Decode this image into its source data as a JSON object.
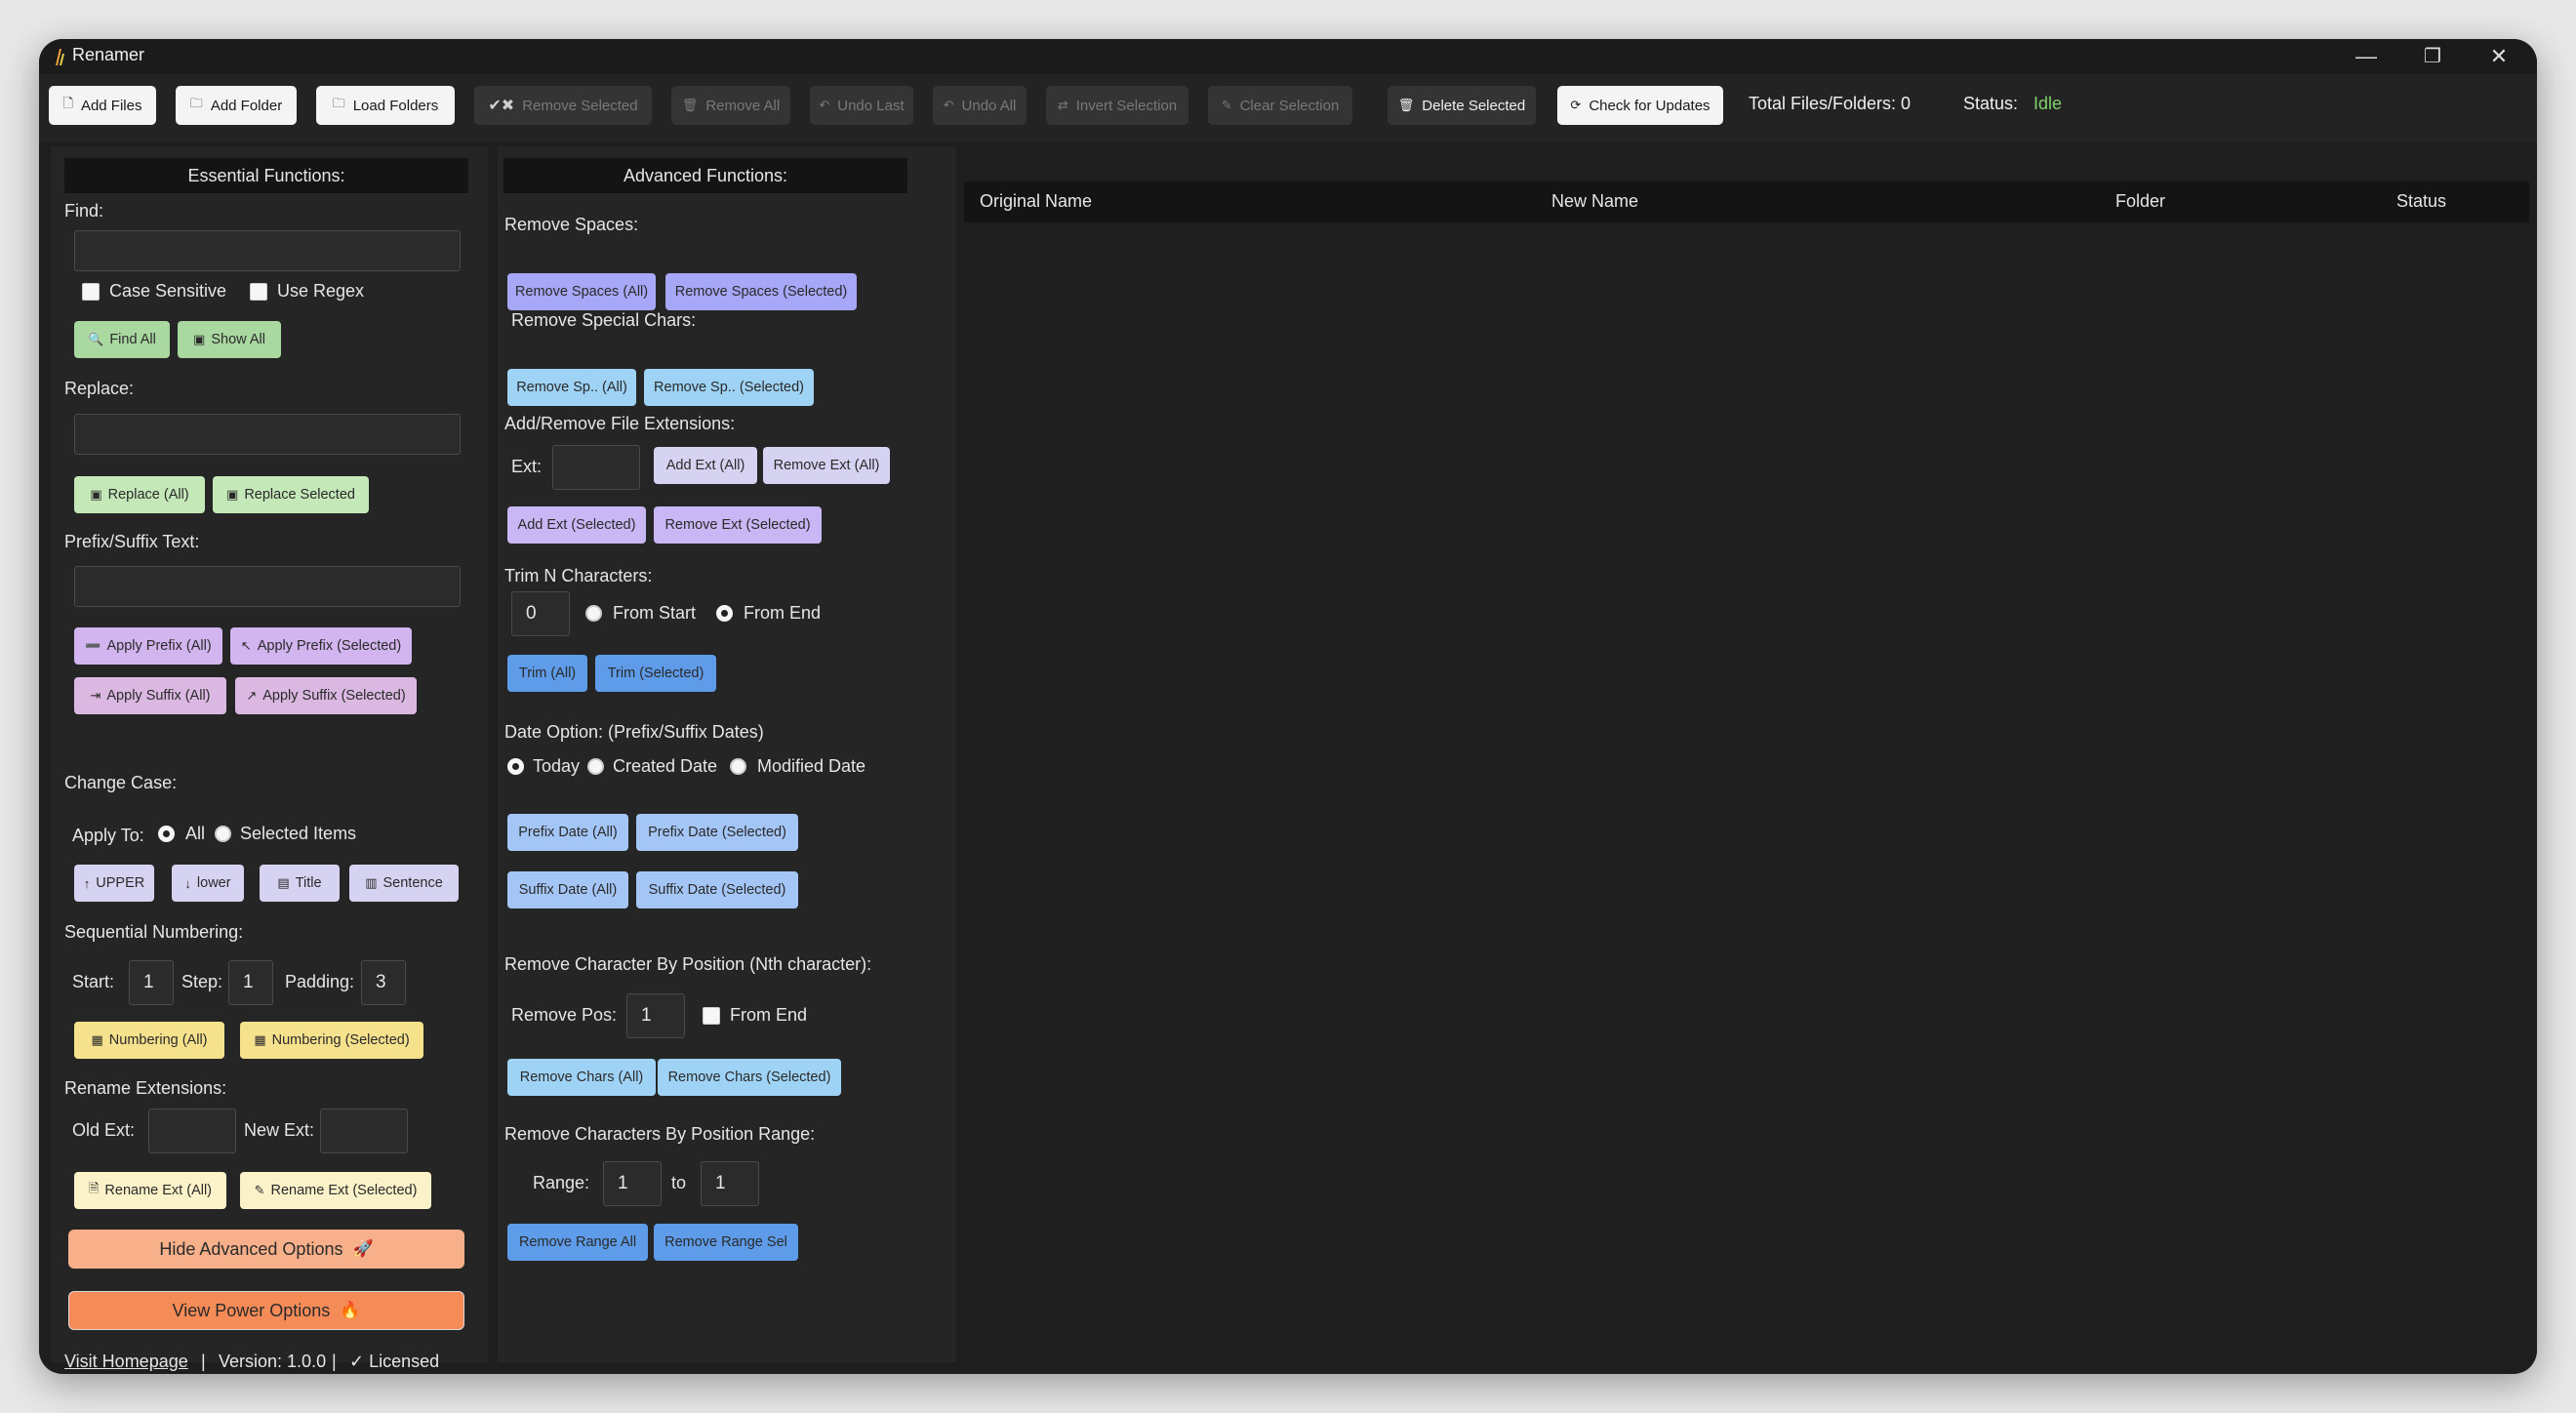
{
  "window": {
    "title": "Renamer",
    "minimize": "—",
    "restore": "❐",
    "close": "✕"
  },
  "toolbar": {
    "add_files": "Add Files",
    "add_folder": "Add Folder",
    "load_folders": "Load Folders",
    "remove_selected": "Remove Selected",
    "remove_all": "Remove All",
    "undo_last": "Undo Last",
    "undo_all": "Undo All",
    "invert_selection": "Invert Selection",
    "clear_selection": "Clear Selection",
    "delete_selected": "Delete Selected",
    "check_updates": "Check for Updates",
    "total": "Total Files/Folders: 0",
    "status_label": "Status:",
    "status_value": "Idle",
    "status_color": "#7fd36a"
  },
  "essential": {
    "header": "Essential Functions:",
    "find_label": "Find:",
    "case_sensitive": "Case Sensitive",
    "use_regex": "Use Regex",
    "find_all": "Find All",
    "show_all": "Show All",
    "replace_label": "Replace:",
    "replace_all": "Replace (All)",
    "replace_selected": "Replace Selected",
    "prefix_label": "Prefix/Suffix Text:",
    "apply_prefix_all": "Apply Prefix (All)",
    "apply_prefix_sel": "Apply Prefix (Selected)",
    "apply_suffix_all": "Apply Suffix (All)",
    "apply_suffix_sel": "Apply Suffix (Selected)",
    "change_case_label": "Change Case:",
    "apply_to": "Apply To:",
    "all": "All",
    "selected_items": "Selected Items",
    "upper": "UPPER",
    "lower": "lower",
    "title": "Title",
    "sentence": "Sentence",
    "seq_label": "Sequential Numbering:",
    "start": "Start:",
    "start_val": "1",
    "step": "Step:",
    "step_val": "1",
    "padding": "Padding:",
    "padding_val": "3",
    "numbering_all": "Numbering (All)",
    "numbering_sel": "Numbering (Selected)",
    "rename_ext_label": "Rename Extensions:",
    "old_ext": "Old Ext:",
    "new_ext": "New Ext:",
    "rename_ext_all": "Rename Ext (All)",
    "rename_ext_sel": "Rename Ext (Selected)",
    "hide_advanced": "Hide Advanced Options",
    "view_power": "View Power Options",
    "visit_homepage": "Visit Homepage",
    "sep1": "|",
    "version": "Version: 1.0.0",
    "sep2": "|",
    "licensed": "✓ Licensed"
  },
  "advanced": {
    "header": "Advanced Functions:",
    "remove_spaces_label": "Remove Spaces:",
    "remove_spaces_all": "Remove Spaces (All)",
    "remove_spaces_sel": "Remove Spaces (Selected)",
    "remove_special_label": "Remove Special Chars:",
    "remove_sp_all": "Remove Sp.. (All)",
    "remove_sp_sel": "Remove Sp.. (Selected)",
    "ext_label": "Add/Remove File Extensions:",
    "ext": "Ext:",
    "add_ext_all": "Add Ext (All)",
    "remove_ext_all": "Remove Ext (All)",
    "add_ext_sel": "Add Ext (Selected)",
    "remove_ext_sel": "Remove Ext (Selected)",
    "trim_label": "Trim N Characters:",
    "trim_val": "0",
    "from_start": "From Start",
    "from_end": "From End",
    "trim_all": "Trim (All)",
    "trim_sel": "Trim (Selected)",
    "date_label": "Date Option: (Prefix/Suffix Dates)",
    "today": "Today",
    "created": "Created Date",
    "modified": "Modified Date",
    "prefix_date_all": "Prefix Date (All)",
    "prefix_date_sel": "Prefix Date (Selected)",
    "suffix_date_all": "Suffix Date (All)",
    "suffix_date_sel": "Suffix Date (Selected)",
    "rcp_label": "Remove Character By Position (Nth character):",
    "remove_pos": "Remove Pos:",
    "remove_pos_val": "1",
    "from_end_chk": "From End",
    "remove_chars_all": "Remove Chars (All)",
    "remove_chars_sel": "Remove Chars (Selected)",
    "range_label": "Remove Characters By Position Range:",
    "range": "Range:",
    "range_from": "1",
    "to": "to",
    "range_to": "1",
    "remove_range_all": "Remove Range All",
    "remove_range_sel": "Remove Range Sel"
  },
  "table": {
    "columns": [
      "Original Name",
      "New Name",
      "Folder",
      "Status"
    ]
  }
}
